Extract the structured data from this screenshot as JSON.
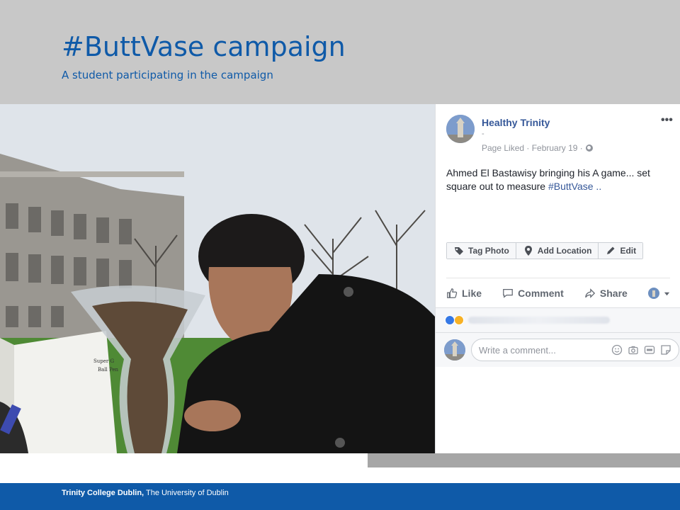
{
  "slide": {
    "title": "#ButtVase campaign",
    "subtitle": "A student participating in the campaign"
  },
  "post": {
    "page_name": "Healthy Trinity",
    "dash": "-",
    "meta": "Page Liked · February 19 ·",
    "more_label": "•••",
    "body_text": "Ahmed El Bastawisy bringing his A game... set square out to measure ",
    "hashtag": "#ButtVase",
    "ellipsis": " ..",
    "tools": {
      "tag_photo": "Tag Photo",
      "add_location": "Add Location",
      "edit": "Edit"
    },
    "actions": {
      "like": "Like",
      "comment": "Comment",
      "share": "Share"
    },
    "comment_placeholder": "Write a comment..."
  },
  "photo_labels": {
    "box_label_line1": "Super G",
    "box_label_line2": "Ball Pen"
  },
  "footer": {
    "institution": "Trinity College Dublin,",
    "university": " The University of Dublin"
  },
  "colors": {
    "title_blue": "#0f5aa8",
    "header_gray": "#c8c8c8",
    "facebook_link": "#365899",
    "footer_blue": "#0f5aa8"
  }
}
